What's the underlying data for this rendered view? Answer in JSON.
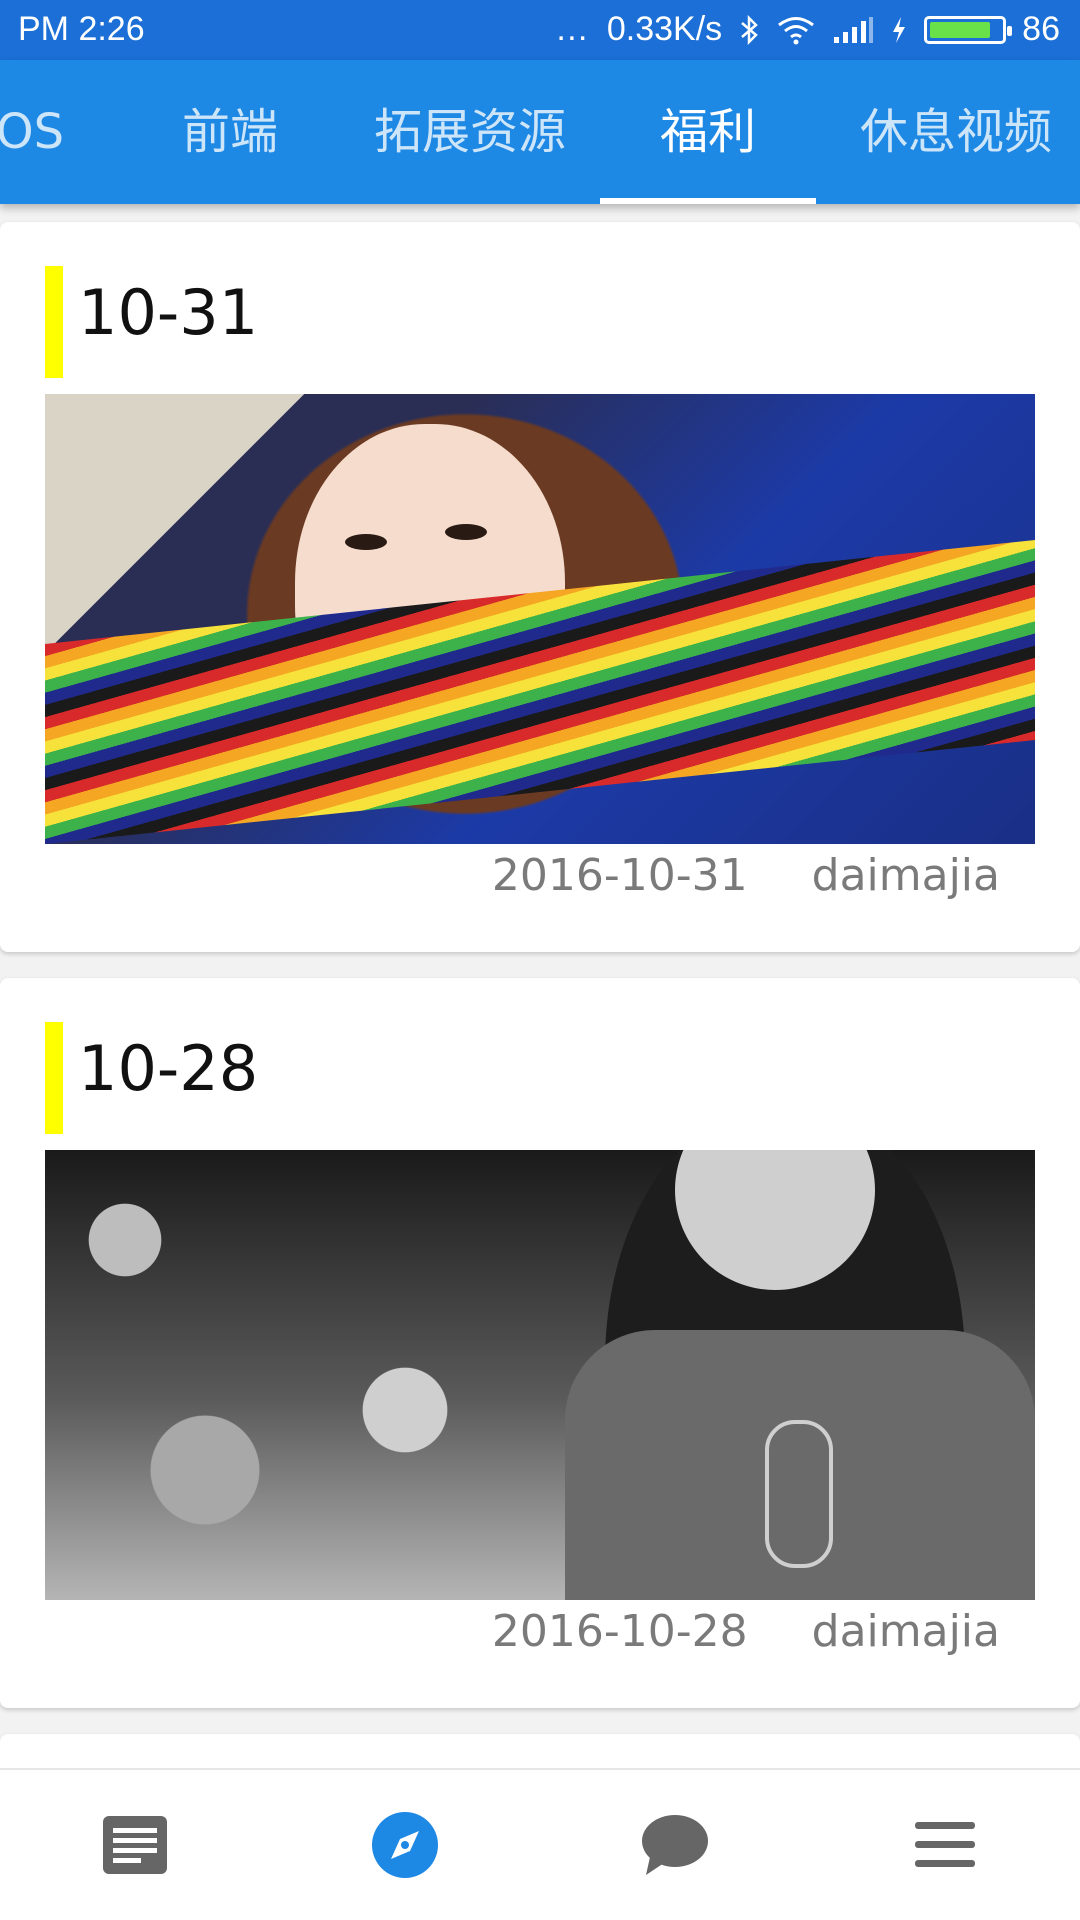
{
  "status_bar": {
    "left_text": "PM  2:26",
    "network_dots": "…",
    "network_speed": "0.33K/s",
    "battery_level": "86",
    "battery_fraction": 0.86
  },
  "tabs": {
    "items": [
      {
        "label": "OS"
      },
      {
        "label": "前端"
      },
      {
        "label": "拓展资源"
      },
      {
        "label": "福利"
      },
      {
        "label": "休息视频"
      }
    ],
    "active_index": 3
  },
  "cards": [
    {
      "title": "10-31",
      "date": "2016-10-31",
      "author": "daimajia"
    },
    {
      "title": "10-28",
      "date": "2016-10-28",
      "author": "daimajia"
    }
  ],
  "bottom_nav": {
    "items": [
      {
        "icon": "article-icon",
        "active": false
      },
      {
        "icon": "compass-icon",
        "active": true
      },
      {
        "icon": "chat-bubble-icon",
        "active": false
      },
      {
        "icon": "menu-icon",
        "active": false
      }
    ]
  },
  "colors": {
    "status_bar": "#1b6fd6",
    "tab_bar": "#1e88e5",
    "accent_bar": "#ffff00",
    "nav_active": "#1e88e5",
    "nav_inactive": "#666666",
    "meta_text": "#7a7a7a"
  }
}
